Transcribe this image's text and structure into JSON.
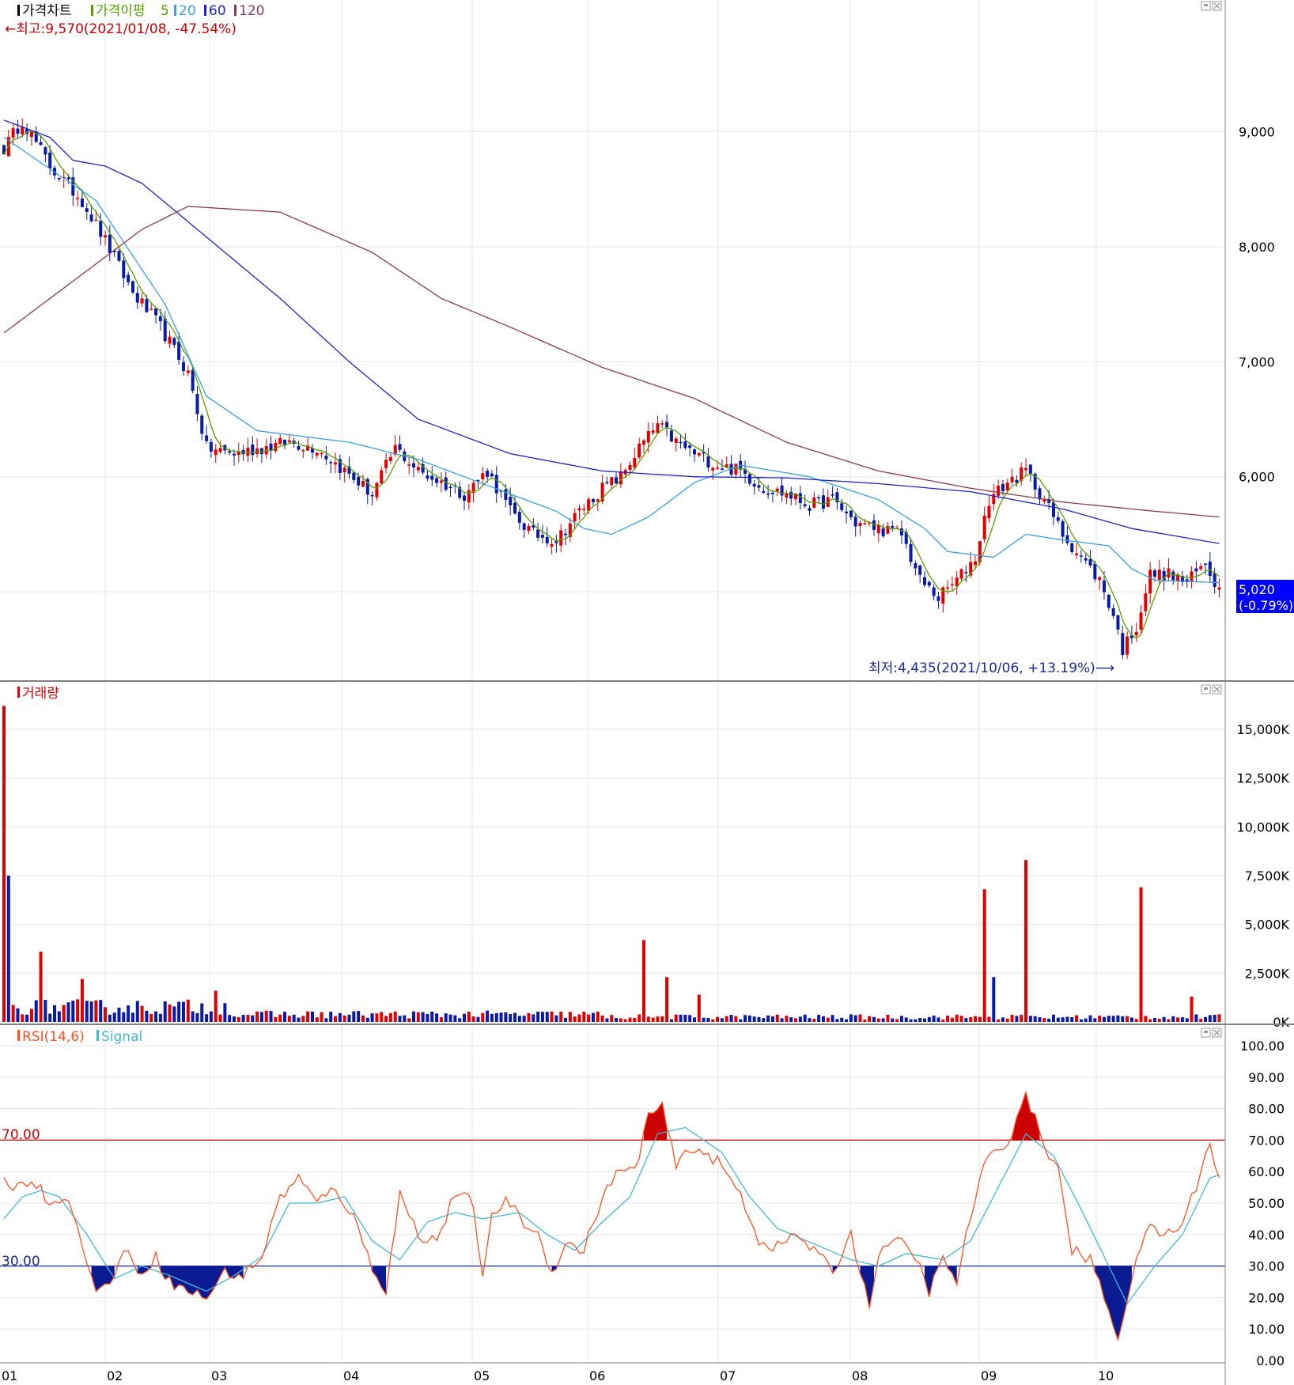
{
  "price_panel": {
    "legend": {
      "chart": "가격차트",
      "ma_label": "가격이평",
      "ma5": "5",
      "ma20": "20",
      "ma60": "60",
      "ma120": "120"
    },
    "high_annotation": "←최고:9,570(2021/01/08, -47.54%)",
    "low_annotation": "최저:4,435(2021/10/06, +13.19%)⟶",
    "current_price": "5,020",
    "current_change": "(-0.79%)"
  },
  "volume_panel": {
    "title": "거래량"
  },
  "rsi_panel": {
    "legend": {
      "rsi": "RSI(14,6)",
      "signal": "Signal"
    },
    "level_high_label": "70.00",
    "level_low_label": "30.00"
  },
  "colors": {
    "up": "#e00000",
    "down": "#0a1aa8",
    "ma5": "#5aa000",
    "ma20": "#3aa0e0",
    "ma60": "#2020d0",
    "ma120": "#8a3a50",
    "rsi": "#ff5020",
    "signal": "#40b8d8",
    "overbought_fill": "#cc0000",
    "oversold_fill": "#0a1a90",
    "grid": "#e6e6e6",
    "panel_border": "#808080",
    "price_box": "#0000ff"
  },
  "icons": {
    "panel_controls": [
      "maximize-icon",
      "close-icon"
    ]
  },
  "chart_data": [
    {
      "type": "candlestick",
      "title": "가격차트",
      "x_tick_labels": [
        "01",
        "02",
        "03",
        "04",
        "05",
        "06",
        "07",
        "08",
        "09",
        "10"
      ],
      "y_tick_labels": [
        "9,000",
        "8,000",
        "7,000",
        "6,000"
      ],
      "ylim": [
        4300,
        9800
      ],
      "series_names": [
        "5",
        "20",
        "60",
        "120"
      ],
      "anchors": [
        {
          "x": 0,
          "close": 8850
        },
        {
          "x": 4,
          "close": 9100
        },
        {
          "x": 10,
          "close": 8700
        },
        {
          "x": 17,
          "close": 8400
        },
        {
          "x": 22,
          "close": 8050
        },
        {
          "x": 28,
          "close": 7600
        },
        {
          "x": 34,
          "close": 7300
        },
        {
          "x": 40,
          "close": 6900
        },
        {
          "x": 44,
          "close": 6250
        },
        {
          "x": 50,
          "close": 6200
        },
        {
          "x": 56,
          "close": 6250
        },
        {
          "x": 62,
          "close": 6300
        },
        {
          "x": 68,
          "close": 6250
        },
        {
          "x": 74,
          "close": 6050
        },
        {
          "x": 80,
          "close": 5850
        },
        {
          "x": 85,
          "close": 6250
        },
        {
          "x": 90,
          "close": 6050
        },
        {
          "x": 95,
          "close": 5950
        },
        {
          "x": 100,
          "close": 5850
        },
        {
          "x": 105,
          "close": 6050
        },
        {
          "x": 110,
          "close": 5700
        },
        {
          "x": 115,
          "close": 5500
        },
        {
          "x": 120,
          "close": 5450
        },
        {
          "x": 125,
          "close": 5700
        },
        {
          "x": 130,
          "close": 5900
        },
        {
          "x": 134,
          "close": 6000
        },
        {
          "x": 138,
          "close": 6250
        },
        {
          "x": 142,
          "close": 6450
        },
        {
          "x": 146,
          "close": 6300
        },
        {
          "x": 150,
          "close": 6200
        },
        {
          "x": 155,
          "close": 6100
        },
        {
          "x": 160,
          "close": 6050
        },
        {
          "x": 165,
          "close": 5900
        },
        {
          "x": 170,
          "close": 5850
        },
        {
          "x": 175,
          "close": 5750
        },
        {
          "x": 180,
          "close": 5800
        },
        {
          "x": 185,
          "close": 5600
        },
        {
          "x": 190,
          "close": 5550
        },
        {
          "x": 195,
          "close": 5500
        },
        {
          "x": 199,
          "close": 5100
        },
        {
          "x": 203,
          "close": 4950
        },
        {
          "x": 207,
          "close": 5100
        },
        {
          "x": 211,
          "close": 5300
        },
        {
          "x": 214,
          "close": 5800
        },
        {
          "x": 218,
          "close": 5950
        },
        {
          "x": 222,
          "close": 6050
        },
        {
          "x": 226,
          "close": 5800
        },
        {
          "x": 230,
          "close": 5500
        },
        {
          "x": 234,
          "close": 5300
        },
        {
          "x": 238,
          "close": 5100
        },
        {
          "x": 241,
          "close": 4800
        },
        {
          "x": 243,
          "close": 4500
        },
        {
          "x": 246,
          "close": 4700
        },
        {
          "x": 249,
          "close": 5150
        },
        {
          "x": 253,
          "close": 5150
        },
        {
          "x": 257,
          "close": 5080
        },
        {
          "x": 261,
          "close": 5250
        },
        {
          "x": 264,
          "close": 5020
        }
      ],
      "ma_anchors": {
        "ma20": [
          [
            0,
            8950
          ],
          [
            20,
            8400
          ],
          [
            35,
            7500
          ],
          [
            44,
            6700
          ],
          [
            55,
            6400
          ],
          [
            75,
            6300
          ],
          [
            90,
            6150
          ],
          [
            110,
            5850
          ],
          [
            120,
            5700
          ],
          [
            126,
            5550
          ],
          [
            132,
            5500
          ],
          [
            140,
            5650
          ],
          [
            150,
            5950
          ],
          [
            160,
            6100
          ],
          [
            175,
            6000
          ],
          [
            190,
            5800
          ],
          [
            200,
            5550
          ],
          [
            205,
            5350
          ],
          [
            215,
            5300
          ],
          [
            222,
            5500
          ],
          [
            230,
            5450
          ],
          [
            240,
            5400
          ],
          [
            245,
            5200
          ],
          [
            250,
            5100
          ],
          [
            264,
            5080
          ]
        ],
        "ma60": [
          [
            0,
            9100
          ],
          [
            10,
            8950
          ],
          [
            15,
            8750
          ],
          [
            22,
            8700
          ],
          [
            30,
            8550
          ],
          [
            45,
            8050
          ],
          [
            60,
            7550
          ],
          [
            75,
            7000
          ],
          [
            90,
            6500
          ],
          [
            110,
            6200
          ],
          [
            130,
            6050
          ],
          [
            150,
            6000
          ],
          [
            170,
            5990
          ],
          [
            190,
            5940
          ],
          [
            210,
            5870
          ],
          [
            230,
            5720
          ],
          [
            245,
            5550
          ],
          [
            264,
            5420
          ]
        ],
        "ma120": [
          [
            0,
            7250
          ],
          [
            15,
            7700
          ],
          [
            30,
            8150
          ],
          [
            40,
            8350
          ],
          [
            60,
            8300
          ],
          [
            80,
            7950
          ],
          [
            95,
            7550
          ],
          [
            110,
            7300
          ],
          [
            130,
            6950
          ],
          [
            150,
            6680
          ],
          [
            170,
            6300
          ],
          [
            190,
            6050
          ],
          [
            210,
            5900
          ],
          [
            230,
            5780
          ],
          [
            250,
            5700
          ],
          [
            264,
            5650
          ]
        ]
      }
    },
    {
      "type": "bar",
      "title": "거래량",
      "y_tick_labels": [
        "15,000K",
        "12,500K",
        "10,000K",
        "7,500K",
        "5,000K",
        "2,500K",
        "0K"
      ],
      "ylim": [
        0,
        16500
      ],
      "spikes": [
        {
          "x": 0,
          "value": 16200,
          "up": true
        },
        {
          "x": 1,
          "value": 7500,
          "up": false
        },
        {
          "x": 8,
          "value": 3600,
          "up": true
        },
        {
          "x": 17,
          "value": 2200,
          "up": true
        },
        {
          "x": 46,
          "value": 1600,
          "up": true
        },
        {
          "x": 139,
          "value": 4200,
          "up": true
        },
        {
          "x": 144,
          "value": 2300,
          "up": true
        },
        {
          "x": 151,
          "value": 1400,
          "up": true
        },
        {
          "x": 213,
          "value": 6800,
          "up": true
        },
        {
          "x": 215,
          "value": 2300,
          "up": false
        },
        {
          "x": 222,
          "value": 8300,
          "up": true
        },
        {
          "x": 247,
          "value": 6900,
          "up": true
        },
        {
          "x": 258,
          "value": 1300,
          "up": true
        }
      ]
    },
    {
      "type": "line",
      "title": "RSI(14,6)",
      "series_names": [
        "RSI(14,6)",
        "Signal"
      ],
      "y_tick_labels": [
        "100.00",
        "90.00",
        "80.00",
        "70.00",
        "60.00",
        "50.00",
        "40.00",
        "30.00",
        "20.00",
        "10.00",
        "0.00"
      ],
      "ylim": [
        0,
        100
      ],
      "levels": [
        70,
        30
      ],
      "rsi_anchors": [
        [
          0,
          57
        ],
        [
          3,
          55
        ],
        [
          6,
          58
        ],
        [
          10,
          50
        ],
        [
          13,
          53
        ],
        [
          17,
          38
        ],
        [
          20,
          21
        ],
        [
          23,
          25
        ],
        [
          26,
          35
        ],
        [
          28,
          31
        ],
        [
          30,
          28
        ],
        [
          33,
          33
        ],
        [
          36,
          25
        ],
        [
          40,
          22
        ],
        [
          44,
          20
        ],
        [
          48,
          28
        ],
        [
          52,
          27
        ],
        [
          56,
          33
        ],
        [
          60,
          52
        ],
        [
          64,
          58
        ],
        [
          68,
          50
        ],
        [
          72,
          55
        ],
        [
          76,
          45
        ],
        [
          80,
          30
        ],
        [
          83,
          22
        ],
        [
          86,
          53
        ],
        [
          90,
          40
        ],
        [
          94,
          38
        ],
        [
          98,
          53
        ],
        [
          102,
          50
        ],
        [
          104,
          25
        ],
        [
          106,
          45
        ],
        [
          109,
          52
        ],
        [
          112,
          45
        ],
        [
          116,
          40
        ],
        [
          119,
          28
        ],
        [
          122,
          37
        ],
        [
          126,
          35
        ],
        [
          129,
          48
        ],
        [
          133,
          60
        ],
        [
          137,
          60
        ],
        [
          140,
          78
        ],
        [
          143,
          80
        ],
        [
          146,
          62
        ],
        [
          150,
          68
        ],
        [
          155,
          63
        ],
        [
          160,
          53
        ],
        [
          164,
          38
        ],
        [
          168,
          36
        ],
        [
          172,
          40
        ],
        [
          176,
          35
        ],
        [
          180,
          28
        ],
        [
          184,
          40
        ],
        [
          188,
          18
        ],
        [
          191,
          38
        ],
        [
          195,
          37
        ],
        [
          198,
          33
        ],
        [
          201,
          22
        ],
        [
          204,
          32
        ],
        [
          207,
          25
        ],
        [
          210,
          46
        ],
        [
          213,
          62
        ],
        [
          216,
          67
        ],
        [
          219,
          72
        ],
        [
          222,
          85
        ],
        [
          225,
          72
        ],
        [
          229,
          60
        ],
        [
          232,
          35
        ],
        [
          236,
          32
        ],
        [
          239,
          20
        ],
        [
          242,
          8
        ],
        [
          245,
          25
        ],
        [
          248,
          42
        ],
        [
          252,
          40
        ],
        [
          256,
          43
        ],
        [
          260,
          60
        ],
        [
          262,
          70
        ],
        [
          264,
          57
        ]
      ],
      "signal_anchors": [
        [
          0,
          45
        ],
        [
          4,
          52
        ],
        [
          8,
          54
        ],
        [
          12,
          52
        ],
        [
          18,
          40
        ],
        [
          24,
          26
        ],
        [
          30,
          30
        ],
        [
          36,
          27
        ],
        [
          44,
          22
        ],
        [
          50,
          27
        ],
        [
          56,
          33
        ],
        [
          62,
          50
        ],
        [
          68,
          50
        ],
        [
          74,
          52
        ],
        [
          80,
          38
        ],
        [
          86,
          32
        ],
        [
          92,
          44
        ],
        [
          98,
          47
        ],
        [
          104,
          45
        ],
        [
          112,
          47
        ],
        [
          118,
          40
        ],
        [
          124,
          35
        ],
        [
          130,
          44
        ],
        [
          136,
          52
        ],
        [
          142,
          72
        ],
        [
          148,
          74
        ],
        [
          156,
          66
        ],
        [
          162,
          52
        ],
        [
          168,
          42
        ],
        [
          176,
          37
        ],
        [
          184,
          32
        ],
        [
          190,
          30
        ],
        [
          196,
          34
        ],
        [
          204,
          32
        ],
        [
          210,
          38
        ],
        [
          216,
          55
        ],
        [
          222,
          72
        ],
        [
          228,
          65
        ],
        [
          234,
          48
        ],
        [
          240,
          30
        ],
        [
          244,
          18
        ],
        [
          250,
          30
        ],
        [
          256,
          40
        ],
        [
          262,
          58
        ],
        [
          264,
          59
        ]
      ]
    }
  ]
}
